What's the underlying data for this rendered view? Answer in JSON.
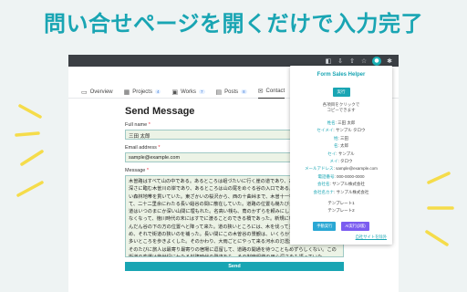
{
  "headline": "問い合せページを開くだけで入力完了",
  "nav": [
    {
      "label": "Overview",
      "icon": "book-icon"
    },
    {
      "label": "Projects",
      "icon": "table-icon",
      "count": "4"
    },
    {
      "label": "Works",
      "icon": "briefcase-icon",
      "count": "7"
    },
    {
      "label": "Posts",
      "icon": "document-icon",
      "count": "8"
    },
    {
      "label": "Contact",
      "icon": "mail-icon"
    }
  ],
  "form": {
    "title": "Send Message",
    "name_label": "Full name",
    "name_value": "三田 太郎",
    "email_label": "Email address",
    "email_value": "sample@example.com",
    "message_label": "Message",
    "message_text": "木曽路はすべて山の中である。あるところは岨づたいに行く崖の道であり、あるところは数十間の深さに臨む木曽川の岸であり、あるところは山の尾をめぐる谷の入口である。一筋の街道はこの深い森林地帯を貫いていた。東ざかいの桜沢から、西の十曲峠まで、木曽十一宿はこの街道に添うて、二十二里余にわたる長い谿谷の間に散在していた。道路の位置も幾たびか改まったもので、古道はいつのまにか深い山間に埋もれた。名高い桟も、蔦のかずらを頼みにしたような危い場処ではなくなって、徳川時代の末にはすでに渡ることのできる橋であった。新規に新規にとできた道はだんだん谷の下の方の位置へと降って来た。道の狭いところには、木を伐って並べ、藤づるでからめ、それで街道の狭いのを補った。長い間にこの木曽谷の景観は、いくらかずつでも嶮岨な山坂の多いところを歩きよくした。そのかわり、大雨ごとにやって来る河水の氾濫が旅行を困難にする。そのたびに旅人は最寄り最寄りの宿場に逗留して、道路の開通を待つこともめずらしくない。この街道の変遷は幾世紀にわたる封建時代の発達をも、その制度組織の用心深さをも語っていた。",
    "send_label": "Send"
  },
  "popup": {
    "title": "Form Sales Helper",
    "run_label": "実行",
    "note_line1": "各項目をクリックで",
    "note_line2": "コピーできます",
    "fields": [
      {
        "key": "姓名",
        "value": "三田 太郎"
      },
      {
        "key": "セイメイ",
        "value": "サンプル タロウ"
      },
      {
        "key": "姓",
        "value": "三田"
      },
      {
        "key": "名",
        "value": "太郎"
      },
      {
        "key": "セイ",
        "value": "サンプル"
      },
      {
        "key": "メイ",
        "value": "タロウ"
      },
      {
        "key": "メールアドレス",
        "value": "sample@example.com"
      },
      {
        "key": "電話番号",
        "value": "000-0000-0000"
      },
      {
        "key": "会社名",
        "value": "サンプル株式会社"
      },
      {
        "key": "会社名カナ",
        "value": "サンプル株式会社"
      }
    ],
    "template1": "テンプレート1",
    "template2": "テンプレート2",
    "action_manual": "手動実行",
    "action_ai": "AI実行(β版)",
    "link": "自社サイトを除外"
  },
  "colors": {
    "accent": "#19a5b3",
    "purple": "#7b5cf0",
    "field_bg": "#ecf3e6",
    "toolbar": "#3b3f44"
  }
}
